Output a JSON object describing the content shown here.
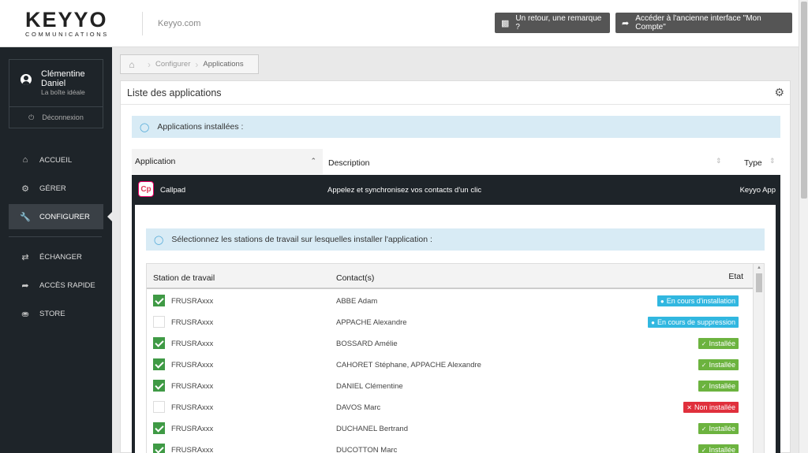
{
  "header": {
    "logo_main": "KEYYO",
    "logo_sub": "COMMUNICATIONS",
    "site_link": "Keyyo.com",
    "feedback_button": "Un retour, une remarque ?",
    "old_interface_button": "Accéder à l'ancienne interface \"Mon Compte\""
  },
  "sidebar": {
    "user": {
      "first_name": "Clémentine",
      "last_name": "Daniel",
      "company": "La boîte idéale"
    },
    "logout": "Déconnexion",
    "items": [
      {
        "label": "ACCUEIL",
        "icon": "home-icon"
      },
      {
        "label": "GÉRER",
        "icon": "manage-icon"
      },
      {
        "label": "CONFIGURER",
        "icon": "wrench-icon",
        "active": true
      },
      {
        "label": "ÉCHANGER",
        "icon": "exchange-icon"
      },
      {
        "label": "ACCÈS RAPIDE",
        "icon": "share-icon"
      },
      {
        "label": "STORE",
        "icon": "cart-icon"
      }
    ]
  },
  "breadcrumb": {
    "home_icon": "home-icon",
    "items": [
      "Configurer",
      "Applications"
    ]
  },
  "panel": {
    "title": "Liste des applications",
    "installed_info": "Applications installées :",
    "columns": {
      "application": "Application",
      "description": "Description",
      "type": "Type"
    },
    "app": {
      "icon_text": "Cp",
      "name": "Callpad",
      "description": "Appelez et synchronisez vos contacts d'un clic",
      "type": "Keyyo App"
    },
    "stations_info": "Sélectionnez les stations de travail sur lesquelles installer l'application :",
    "sub_columns": {
      "workstation": "Station de travail",
      "contacts": "Contact(s)",
      "state": "Etat"
    },
    "rows": [
      {
        "checked": true,
        "workstation": "FRUSRAxxx",
        "contacts": "ABBE Adam",
        "state": "En cours d'installation",
        "state_type": "progress"
      },
      {
        "checked": false,
        "workstation": "FRUSRAxxx",
        "contacts": "APPACHE Alexandre",
        "state": "En cours de suppression",
        "state_type": "progress"
      },
      {
        "checked": true,
        "workstation": "FRUSRAxxx",
        "contacts": "BOSSARD Amélie",
        "state": "Installée",
        "state_type": "installed"
      },
      {
        "checked": true,
        "workstation": "FRUSRAxxx",
        "contacts": "CAHORET Stéphane, APPACHE Alexandre",
        "state": "Installée",
        "state_type": "installed"
      },
      {
        "checked": true,
        "workstation": "FRUSRAxxx",
        "contacts": "DANIEL Clémentine",
        "state": "Installée",
        "state_type": "installed"
      },
      {
        "checked": false,
        "workstation": "FRUSRAxxx",
        "contacts": "DAVOS Marc",
        "state": "Non installée",
        "state_type": "not-installed"
      },
      {
        "checked": true,
        "workstation": "FRUSRAxxx",
        "contacts": "DUCHANEL Bertrand",
        "state": "Installée",
        "state_type": "installed"
      },
      {
        "checked": true,
        "workstation": "FRUSRAxxx",
        "contacts": "DUCOTTON Marc",
        "state": "Installée",
        "state_type": "installed"
      }
    ]
  },
  "colors": {
    "sidebar_bg": "#1e2429",
    "info_bg": "#d8ebf5",
    "progress": "#31b7e0",
    "installed": "#6cb33f",
    "not_installed": "#e0303c",
    "checkbox_on": "#3f9a45"
  }
}
